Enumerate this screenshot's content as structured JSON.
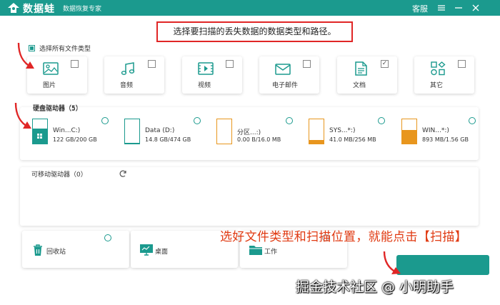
{
  "titlebar": {
    "logo_text": "数据蛙",
    "subtitle": "数据恢复专家",
    "service_label": "客服"
  },
  "banner": {
    "text": "选择要扫描的丢失数据的数据类型和路径。"
  },
  "select_all": {
    "label": "选择所有文件类型",
    "checked": true
  },
  "file_types": [
    {
      "label": "图片",
      "checked": false,
      "icon": "image-icon"
    },
    {
      "label": "音频",
      "checked": false,
      "icon": "music-icon"
    },
    {
      "label": "视频",
      "checked": false,
      "icon": "video-icon"
    },
    {
      "label": "电子邮件",
      "checked": false,
      "icon": "email-icon"
    },
    {
      "label": "文档",
      "checked": true,
      "icon": "document-icon"
    },
    {
      "label": "其它",
      "checked": false,
      "icon": "other-icon"
    }
  ],
  "hard_drives": {
    "title": "硬盘驱动器（5）",
    "items": [
      {
        "name": "Win...C:)",
        "size": "122 GB/200 GB",
        "used_ratio": 0.61,
        "color": "#1b9a8e",
        "selected": true
      },
      {
        "name": "Data (D:)",
        "size": "14.8 GB/474 GB",
        "used_ratio": 0.03,
        "color": "#1b9a8e",
        "selected": false
      },
      {
        "name": "分区...:)",
        "size": "0.00  B/16.0 MB",
        "used_ratio": 0.0,
        "color": "#e8961e",
        "selected": false
      },
      {
        "name": "SYS...*:)",
        "size": "41.0 MB/256 MB",
        "used_ratio": 0.16,
        "color": "#e8961e",
        "selected": false
      },
      {
        "name": "WIN...*:)",
        "size": "893 MB/1.56 GB",
        "used_ratio": 0.56,
        "color": "#e8961e",
        "selected": false
      }
    ]
  },
  "removable": {
    "title": "可移动驱动器（0）"
  },
  "locations": [
    {
      "label": "回收站",
      "icon": "recycle-bin-icon"
    },
    {
      "label": "桌面",
      "icon": "desktop-icon"
    },
    {
      "label": "工作",
      "icon": "folder-icon"
    }
  ],
  "annotation": {
    "text": "选好文件类型和扫描位置，就能点击【扫描】"
  },
  "watermark": {
    "text": "掘金技术社区 @ 小明助手"
  },
  "colors": {
    "accent": "#1b9a8e",
    "warning": "#e8961e",
    "annotation": "#e03a12"
  }
}
